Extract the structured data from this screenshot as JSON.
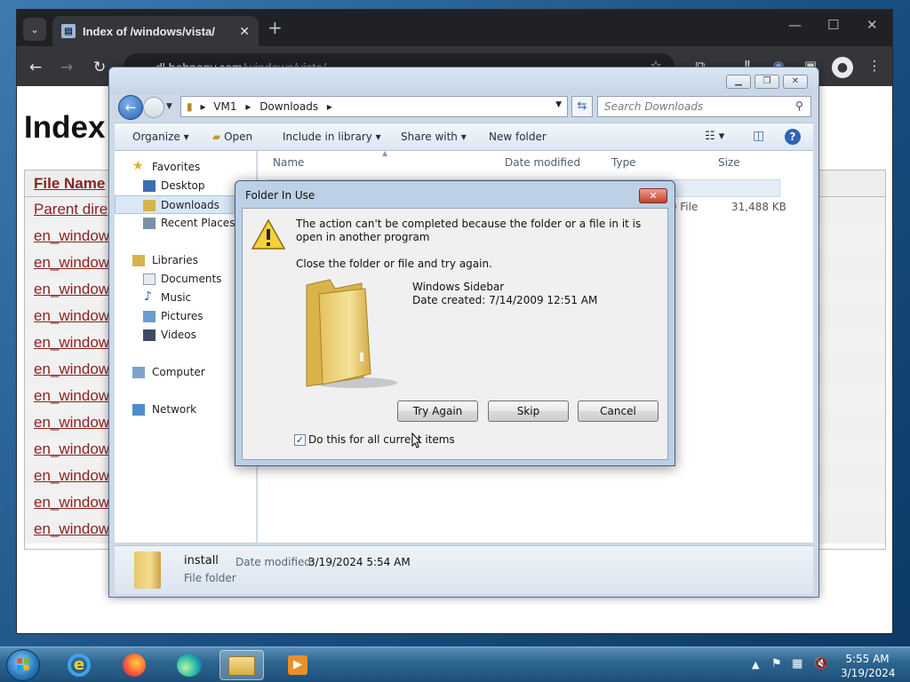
{
  "browser": {
    "tab_title": "Index of /windows/vista/",
    "url_host": "dl.bobpony.com",
    "url_path": "/windows/vista/"
  },
  "webpage": {
    "heading": "Index",
    "column_header": "File Name",
    "rows": [
      "Parent dire",
      "en_window",
      "en_window",
      "en_window",
      "en_window",
      "en_window",
      "en_window",
      "en_window",
      "en_window",
      "en_window",
      "en_window",
      "en_window",
      "en_window"
    ]
  },
  "explorer": {
    "breadcrumb": [
      "VM1",
      "Downloads"
    ],
    "search_placeholder": "Search Downloads",
    "commands": {
      "organize": "Organize",
      "open": "Open",
      "include": "Include in library",
      "share": "Share with",
      "new_folder": "New folder"
    },
    "nav": {
      "favorites": "Favorites",
      "desktop": "Desktop",
      "downloads": "Downloads",
      "recent": "Recent Places",
      "libraries": "Libraries",
      "documents": "Documents",
      "music": "Music",
      "pictures": "Pictures",
      "videos": "Videos",
      "computer": "Computer",
      "network": "Network"
    },
    "columns": {
      "name": "Name",
      "date": "Date modified",
      "type": "Type",
      "size": "Size"
    },
    "row_type_partial": "AD File",
    "row_size": "31,488 KB",
    "details": {
      "name": "install",
      "date_label": "Date modified:",
      "date_value": "3/19/2024 5:54 AM",
      "type": "File folder"
    }
  },
  "dialog": {
    "title": "Folder In Use",
    "message": "The action can't be completed because the folder or a file in it is open in another program",
    "instruction": "Close the folder or file and try again.",
    "folder_name": "Windows Sidebar",
    "folder_date": "Date created: 7/14/2009 12:51 AM",
    "buttons": {
      "try_again": "Try Again",
      "skip": "Skip",
      "cancel": "Cancel"
    },
    "checkbox_label": "Do this for all current items",
    "checkbox_checked": true
  },
  "taskbar": {
    "time": "5:55 AM",
    "date": "3/19/2024"
  }
}
